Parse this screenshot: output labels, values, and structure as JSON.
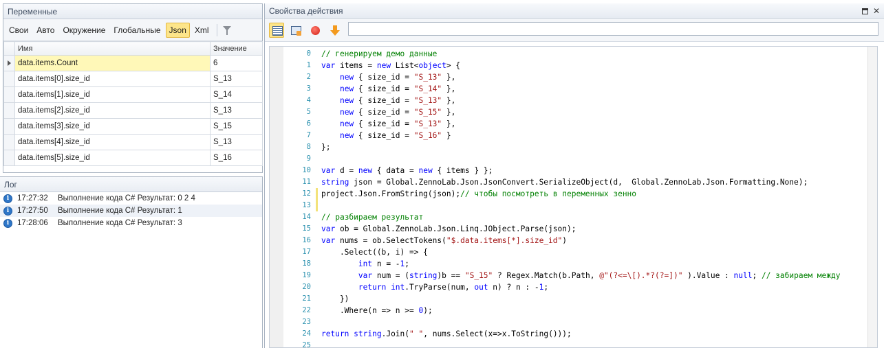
{
  "variables_panel": {
    "title": "Переменные",
    "tabs": [
      "Свои",
      "Авто",
      "Окружение",
      "Глобальные",
      "Json",
      "Xml"
    ],
    "active_tab": "Json",
    "columns": {
      "name": "Имя",
      "value": "Значение"
    },
    "rows": [
      {
        "name": "data.items.Count",
        "value": "6"
      },
      {
        "name": "data.items[0].size_id",
        "value": "S_13"
      },
      {
        "name": "data.items[1].size_id",
        "value": "S_14"
      },
      {
        "name": "data.items[2].size_id",
        "value": "S_13"
      },
      {
        "name": "data.items[3].size_id",
        "value": "S_15"
      },
      {
        "name": "data.items[4].size_id",
        "value": "S_13"
      },
      {
        "name": "data.items[5].size_id",
        "value": "S_16"
      }
    ]
  },
  "log_panel": {
    "title": "Лог",
    "entries": [
      {
        "time": "17:27:32",
        "message": "Выполнение кода C#  Результат: 0 2 4"
      },
      {
        "time": "17:27:50",
        "message": "Выполнение кода C#  Результат: 1"
      },
      {
        "time": "17:28:06",
        "message": "Выполнение кода C#  Результат: 3"
      }
    ]
  },
  "props_panel": {
    "title": "Свойства действия",
    "search_value": ""
  },
  "code_lines": [
    {
      "n": "0",
      "html": "<span class=\"cm\">// генерируем демо данные</span>"
    },
    {
      "n": "1",
      "html": "<span class=\"kw\">var</span> items = <span class=\"kw\">new</span> List&lt;<span class=\"kw\">object</span>&gt; {"
    },
    {
      "n": "2",
      "html": "    <span class=\"kw\">new</span> { size_id = <span class=\"str\">\"S_13\"</span> },"
    },
    {
      "n": "3",
      "html": "    <span class=\"kw\">new</span> { size_id = <span class=\"str\">\"S_14\"</span> },"
    },
    {
      "n": "4",
      "html": "    <span class=\"kw\">new</span> { size_id = <span class=\"str\">\"S_13\"</span> },"
    },
    {
      "n": "5",
      "html": "    <span class=\"kw\">new</span> { size_id = <span class=\"str\">\"S_15\"</span> },"
    },
    {
      "n": "6",
      "html": "    <span class=\"kw\">new</span> { size_id = <span class=\"str\">\"S_13\"</span> },"
    },
    {
      "n": "7",
      "html": "    <span class=\"kw\">new</span> { size_id = <span class=\"str\">\"S_16\"</span> }"
    },
    {
      "n": "8",
      "html": "};"
    },
    {
      "n": "9",
      "html": ""
    },
    {
      "n": "10",
      "html": "<span class=\"kw\">var</span> d = <span class=\"kw\">new</span> { data = <span class=\"kw\">new</span> { items } };"
    },
    {
      "n": "11",
      "html": "<span class=\"kw\">string</span> json = Global.ZennoLab.Json.JsonConvert.SerializeObject(d,  Global.ZennoLab.Json.Formatting.None);"
    },
    {
      "n": "12",
      "html": "project.Json.FromString(json);<span class=\"cm\">// чтобы посмотреть в переменных зенно</span>"
    },
    {
      "n": "13",
      "html": ""
    },
    {
      "n": "14",
      "html": "<span class=\"cm\">// разбираем результат</span>"
    },
    {
      "n": "15",
      "html": "<span class=\"kw\">var</span> ob = Global.ZennoLab.Json.Linq.JObject.Parse(json);"
    },
    {
      "n": "16",
      "html": "<span class=\"kw\">var</span> nums = ob.SelectTokens(<span class=\"str\">\"$.data.items[*].size_id\"</span>)"
    },
    {
      "n": "17",
      "html": "    .Select((b, i) =&gt; {"
    },
    {
      "n": "18",
      "html": "        <span class=\"kw\">int</span> n = -<span class=\"kw\">1</span>;"
    },
    {
      "n": "19",
      "html": "        <span class=\"kw\">var</span> num = (<span class=\"kw\">string</span>)b == <span class=\"str\">\"S_15\"</span> ? Regex.Match(b.Path, <span class=\"str\">@\"(?&lt;=\\[).*?(?=])\"</span> ).Value : <span class=\"kw\">null</span>; <span class=\"cm\">// забираем между</span>"
    },
    {
      "n": "20",
      "html": "        <span class=\"kw\">return</span> <span class=\"kw\">int</span>.TryParse(num, <span class=\"kw\">out</span> n) ? n : -<span class=\"kw\">1</span>;"
    },
    {
      "n": "21",
      "html": "    })"
    },
    {
      "n": "22",
      "html": "    .Where(n =&gt; n &gt;= <span class=\"kw\">0</span>);"
    },
    {
      "n": "23",
      "html": ""
    },
    {
      "n": "24",
      "html": "<span class=\"kw\">return</span> <span class=\"kw\">string</span>.Join(<span class=\"str\">\" \"</span>, nums.Select(x=&gt;x.ToString()));"
    },
    {
      "n": "25",
      "html": ""
    }
  ]
}
